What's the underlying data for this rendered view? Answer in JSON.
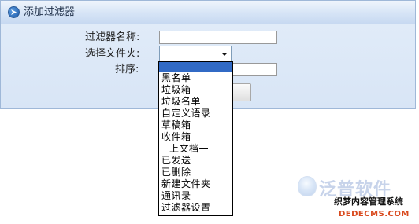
{
  "panel": {
    "title": "添加过滤器"
  },
  "form": {
    "name_label": "过滤器名称:",
    "name_value": "",
    "folder_label": "选择文件夹:",
    "folder_value": "",
    "sort_label": "排序:",
    "sort_value": ""
  },
  "dropdown": {
    "items": [
      "",
      "黑名单",
      "垃圾箱",
      "垃圾名单",
      "自定义语录",
      "草稿箱",
      "收件箱",
      "上文档一",
      "已发送",
      "已删除",
      "新建文件夹",
      "通讯录",
      "过滤器设置"
    ],
    "selected_index": 0
  },
  "watermark": {
    "logo_text": "泛普软件",
    "brand_text": "织梦内容管理系统",
    "domain_text": "DEDECMS.COM"
  },
  "colors": {
    "panel_bg": "#dbe7f7",
    "panel_border": "#9fb8d8",
    "selection_bg": "#316ac5",
    "watermark_brand": "#d94a1e"
  },
  "icons": {
    "header": "filter-add-icon",
    "select": "chevron-down-icon"
  }
}
